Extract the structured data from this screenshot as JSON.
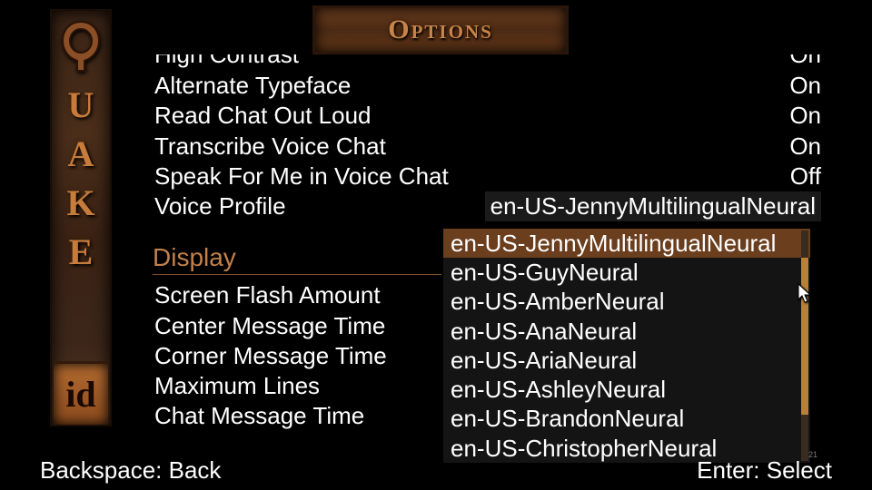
{
  "title": "Options",
  "side_letters": [
    "U",
    "A",
    "K",
    "E"
  ],
  "id_logo": "id",
  "rows_top": [
    {
      "label": "High Contrast",
      "value": "On",
      "cut": true
    },
    {
      "label": "Alternate Typeface",
      "value": "On"
    },
    {
      "label": "Read Chat Out Loud",
      "value": "On"
    },
    {
      "label": "Transcribe Voice Chat",
      "value": "On"
    },
    {
      "label": "Speak For Me in Voice Chat",
      "value": "Off"
    },
    {
      "label": "Voice Profile",
      "value": "en-US-JennyMultilingualNeural",
      "dropdown": true
    }
  ],
  "section": "Display",
  "rows_display": [
    {
      "label": "Screen Flash Amount"
    },
    {
      "label": "Center Message Time"
    },
    {
      "label": "Corner Message Time"
    },
    {
      "label": "Maximum Lines"
    },
    {
      "label": "Chat Message Time"
    }
  ],
  "dropdown": {
    "selected_index": 0,
    "options": [
      "en-US-JennyMultilingualNeural",
      "en-US-GuyNeural",
      "en-US-AmberNeural",
      "en-US-AnaNeural",
      "en-US-AriaNeural",
      "en-US-AshleyNeural",
      "en-US-BrandonNeural",
      "en-US-ChristopherNeural"
    ]
  },
  "footer": {
    "left": "Backspace: Back",
    "right": "Enter: Select"
  },
  "tiny": "21",
  "colors": {
    "accent": "#c3804a",
    "highlight": "#6b3e1e",
    "scroll_thumb": "#b98037"
  }
}
